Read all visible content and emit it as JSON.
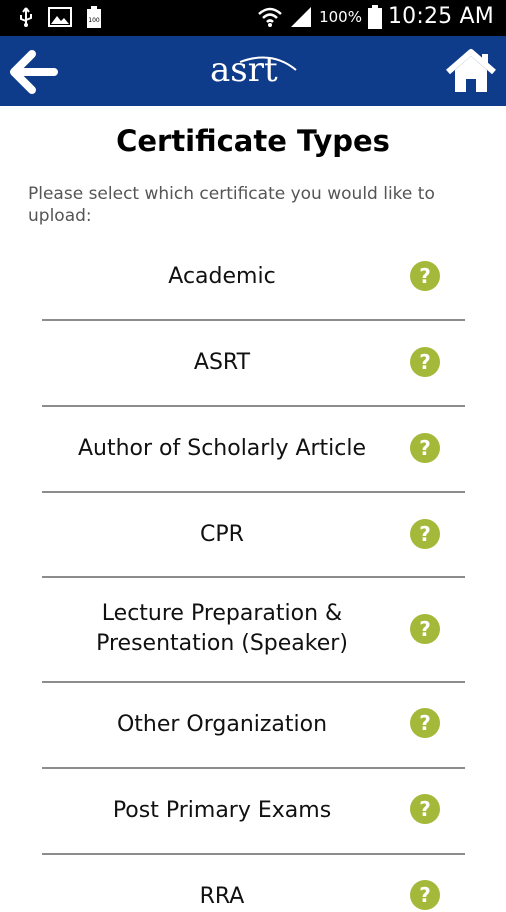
{
  "status_bar": {
    "battery_percent": "100%",
    "time": "10:25 AM",
    "icons": [
      "usb-icon",
      "image-icon",
      "battery-small-icon",
      "wifi-icon",
      "signal-icon",
      "battery-icon"
    ]
  },
  "header": {
    "logo_text": "asrt",
    "back_icon": "arrow-left-icon",
    "home_icon": "home-icon",
    "background_color": "#0e3b8a"
  },
  "main": {
    "title": "Certificate Types",
    "instruction": "Please select which certificate you would like to upload:"
  },
  "certificates": [
    {
      "label": "Academic"
    },
    {
      "label": "ASRT"
    },
    {
      "label": "Author of Scholarly Article"
    },
    {
      "label": "CPR"
    },
    {
      "label": "Lecture Preparation & Presentation (Speaker)"
    },
    {
      "label": "Other Organization"
    },
    {
      "label": "Post Primary Exams"
    },
    {
      "label": "RRA"
    }
  ],
  "help_icon_glyph": "?",
  "colors": {
    "help_icon": "#a4b83a",
    "divider": "#8c8c8c"
  }
}
